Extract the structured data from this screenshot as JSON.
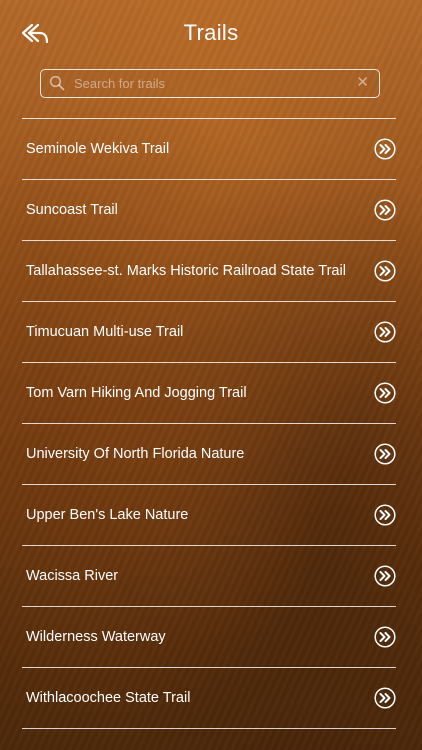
{
  "header": {
    "title": "Trails",
    "back_icon": "back-arrow-icon"
  },
  "search": {
    "placeholder": "Search for trails",
    "value": "",
    "search_icon": "magnifier-icon",
    "clear_icon": "clear-x-icon",
    "clear_glyph": "✕"
  },
  "list": {
    "items": [
      {
        "label": "Seminole Wekiva Trail"
      },
      {
        "label": "Suncoast Trail"
      },
      {
        "label": "Tallahassee-st. Marks Historic Railroad State Trail"
      },
      {
        "label": "Timucuan Multi-use Trail"
      },
      {
        "label": "Tom Varn Hiking And Jogging Trail"
      },
      {
        "label": "University Of North Florida Nature"
      },
      {
        "label": "Upper Ben's Lake Nature"
      },
      {
        "label": "Wacissa River"
      },
      {
        "label": "Wilderness Waterway"
      },
      {
        "label": "Withlacoochee State Trail"
      }
    ],
    "item_icon": "double-chevron-right-circle-icon"
  },
  "colors": {
    "background_top": "#b4692a",
    "background_bottom": "#4d280a",
    "text": "#ffffff"
  }
}
